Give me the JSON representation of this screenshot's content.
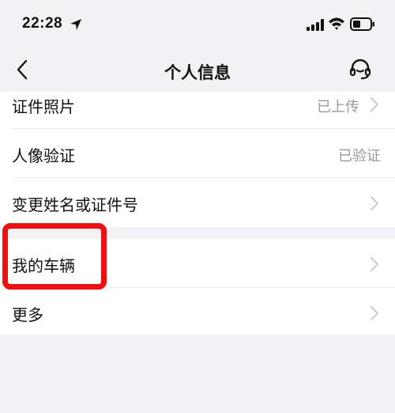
{
  "status_bar": {
    "time": "22:28",
    "icons": [
      "location-arrow-icon",
      "cellular-signal-icon",
      "wifi-icon",
      "battery-icon"
    ]
  },
  "nav": {
    "title": "个人信息",
    "back_icon": "chevron-left-icon",
    "support_icon": "customer-service-headset-icon"
  },
  "groups": [
    {
      "items": [
        {
          "label": "证件照片",
          "value": "已上传",
          "chevron": true
        },
        {
          "label": "人像验证",
          "value": "已验证",
          "chevron": false
        },
        {
          "label": "变更姓名或证件号",
          "value": "",
          "chevron": true
        }
      ]
    },
    {
      "items": [
        {
          "label": "我的车辆",
          "value": "",
          "chevron": true
        },
        {
          "label": "更多",
          "value": "",
          "chevron": true
        }
      ]
    }
  ],
  "colors": {
    "background": "#f2f2f4",
    "card": "#ffffff",
    "secondary_text": "#9a9a9a",
    "highlight": "#ee1111"
  }
}
